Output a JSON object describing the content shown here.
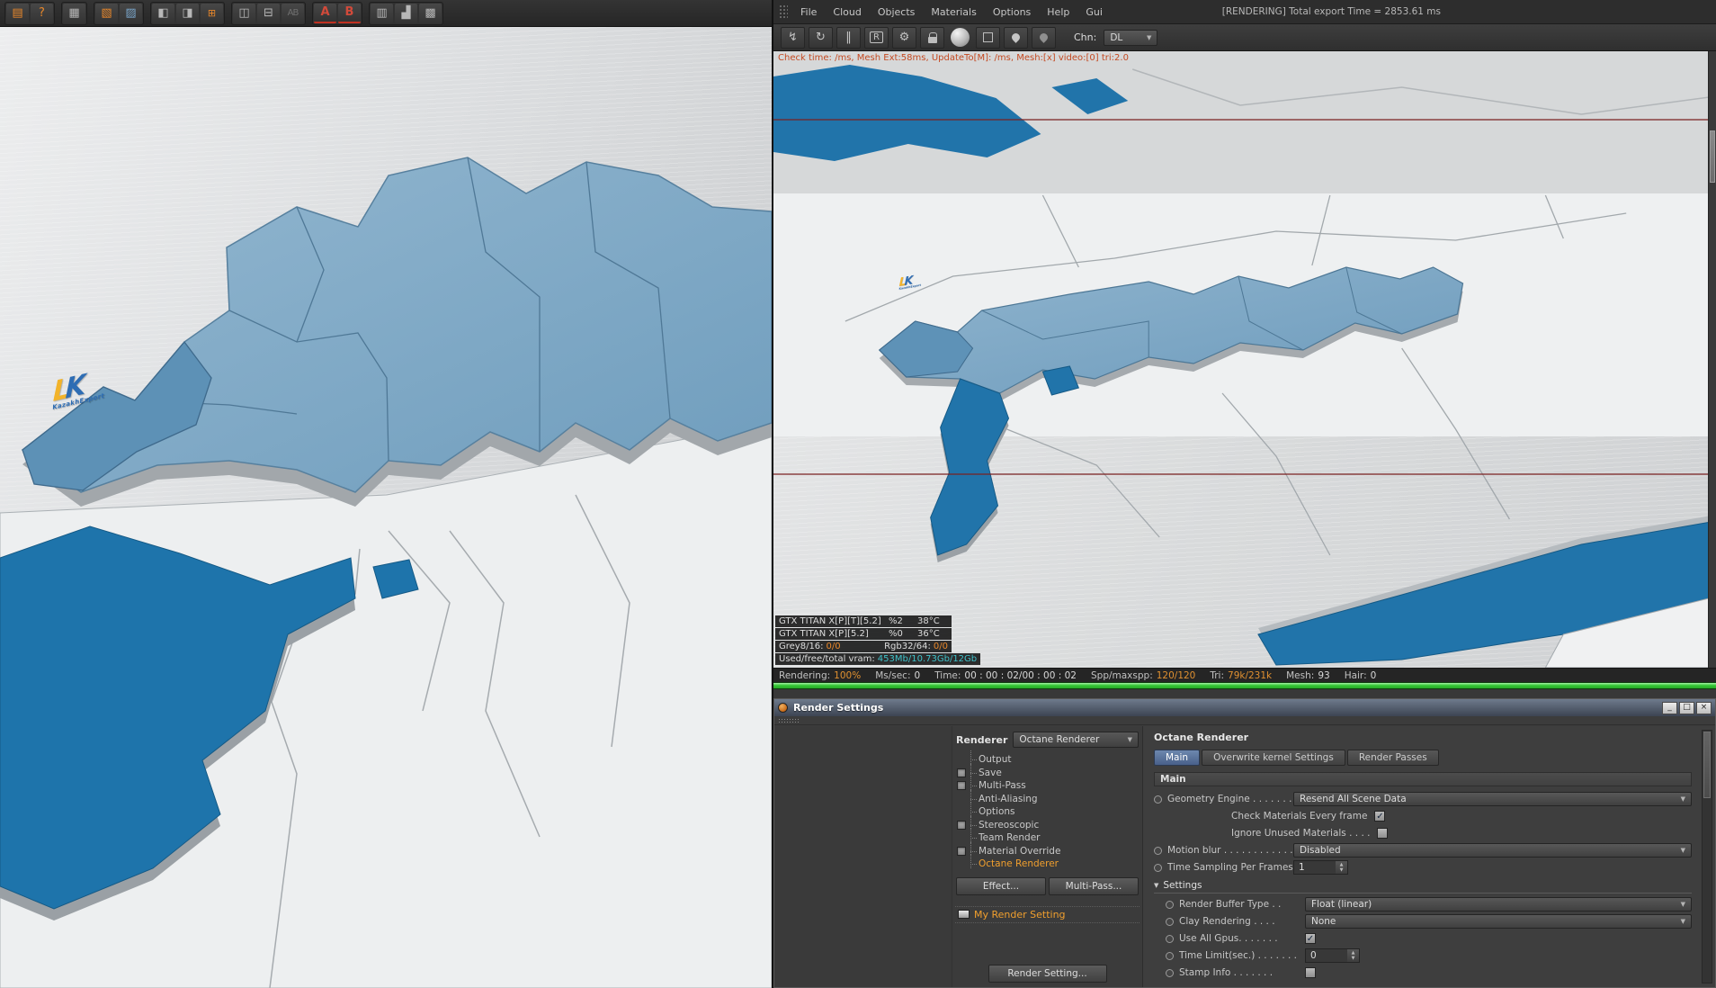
{
  "colors": {
    "accent_orange": "#e8952f",
    "debug_orange": "#c44a22",
    "vram_teal": "#3fc1c9",
    "progress_green": "#36c836",
    "country_blue": "#7fa9c6",
    "sea_blue": "#2174aa",
    "tab_active_blue": "#49608a"
  },
  "icons": {
    "dropdown_arrow": "▼",
    "spin_up": "▲",
    "spin_down": "▼",
    "collapse_arrow": "▼",
    "restart": "↯",
    "refresh": "↻",
    "pause": "‖",
    "reset": "R",
    "gear": "⚙"
  },
  "left_toolbar": {
    "icons": [
      {
        "name": "scene-image-icon",
        "glyph": "▤"
      },
      {
        "name": "save-question-icon",
        "glyph": "?"
      },
      {
        "name": "channels-grid-icon",
        "glyph": "▦"
      },
      {
        "name": "layer-red-icon",
        "glyph": "▧"
      },
      {
        "name": "layer-copy-icon",
        "glyph": "▨"
      },
      {
        "name": "tile-left-icon",
        "glyph": "◧"
      },
      {
        "name": "tile-right-icon",
        "glyph": "◨"
      },
      {
        "name": "tile-add-icon",
        "glyph": "⊞"
      },
      {
        "name": "compare-ab-icon",
        "glyph": "◫"
      },
      {
        "name": "compare-stack-icon",
        "glyph": "⊟"
      },
      {
        "name": "compare-text-icon",
        "glyph": "AB"
      },
      {
        "name": "channel-a-icon",
        "glyph": "A"
      },
      {
        "name": "channel-b-icon",
        "glyph": "B"
      },
      {
        "name": "stats-table-icon",
        "glyph": "▥"
      },
      {
        "name": "histogram-icon",
        "glyph": "▟"
      },
      {
        "name": "grid-info-icon",
        "glyph": "▩"
      }
    ]
  },
  "left_viewport": {
    "logo_l": "L",
    "logo_k": "K",
    "logo_caption": "KazakhExport"
  },
  "live_viewer": {
    "menubar": {
      "menus": [
        "File",
        "Cloud",
        "Objects",
        "Materials",
        "Options",
        "Help",
        "Gui"
      ],
      "status_text": "[RENDERING] Total export Time = 2853.61 ms"
    },
    "toolbar": {
      "channel_label": "Chn:",
      "channel_value": "DL"
    },
    "debug_text": "Check time: /ms, Mesh Ext:58ms, UpdateTo[M]: /ms, Mesh:[x] video:[0] tri:2.0",
    "gpu": {
      "rows": [
        {
          "name": "GTX TITAN X[P][T][5.2]",
          "load": "%2",
          "temp": "38°C"
        },
        {
          "name": "GTX TITAN X[P][5.2]",
          "load": "%0",
          "temp": "36°C"
        }
      ],
      "grey_label": "Grey8/16:",
      "grey_value": "0/0",
      "rgb_label": "Rgb32/64:",
      "rgb_value": "0/0",
      "vram_label": "Used/free/total vram:",
      "vram_value": "453Mb/10.73Gb/12Gb"
    },
    "status": {
      "items": [
        {
          "label": "Rendering:",
          "value": "100%"
        },
        {
          "label": "Ms/sec:",
          "value": "0"
        },
        {
          "label": "Time:",
          "value": "00 : 00 : 02/00 : 00 : 02"
        },
        {
          "label": "Spp/maxspp:",
          "value": "120/120"
        },
        {
          "label": "Tri:",
          "value": "79k/231k"
        },
        {
          "label": "Mesh:",
          "value": "93"
        },
        {
          "label": "Hair:",
          "value": "0"
        }
      ]
    }
  },
  "render_settings": {
    "title": "Render Settings",
    "window_buttons": {
      "minimize": "_",
      "maximize": "□",
      "close": "×"
    },
    "renderer_label": "Renderer",
    "renderer_value": "Octane Renderer",
    "tree": [
      {
        "label": "Output"
      },
      {
        "label": "Save"
      },
      {
        "label": "Multi-Pass"
      },
      {
        "label": "Anti-Aliasing"
      },
      {
        "label": "Options"
      },
      {
        "label": "Stereoscopic"
      },
      {
        "label": "Team Render"
      },
      {
        "label": "Material Override"
      },
      {
        "label": "Octane Renderer"
      }
    ],
    "effect_button": "Effect...",
    "multipass_button": "Multi-Pass...",
    "my_render_setting": "My Render Setting",
    "render_setting_button": "Render Setting...",
    "panel": {
      "header": "Octane Renderer",
      "tabs": [
        "Main",
        "Overwrite kernel Settings",
        "Render Passes"
      ],
      "section": "Main",
      "rows": {
        "geometry_engine": {
          "label": "Geometry Engine . . . . . . .",
          "value": "Resend All Scene Data"
        },
        "check_materials": {
          "label": "Check Materials Every frame",
          "check": "✓"
        },
        "ignore_unused": {
          "label": "Ignore Unused Materials . . . .",
          "check": ""
        },
        "motion_blur": {
          "label": "Motion blur . . . . . . . . . . . .",
          "value": "Disabled"
        },
        "time_sampling": {
          "label": "Time Sampling Per Frames . .",
          "value": "1"
        },
        "settings_group": {
          "label": "Settings"
        },
        "render_buffer": {
          "label": "Render Buffer Type . .",
          "value": "Float (linear)"
        },
        "clay_rendering": {
          "label": "Clay Rendering . . . .",
          "value": "None"
        },
        "use_all_gpus": {
          "label": "Use All Gpus. . . . . . .",
          "check": "✓"
        },
        "time_limit": {
          "label": "Time Limit(sec.) . . . . . . .",
          "value": "0"
        },
        "stamp_info": {
          "label": "Stamp Info . . . . . . .",
          "check": ""
        }
      }
    }
  }
}
